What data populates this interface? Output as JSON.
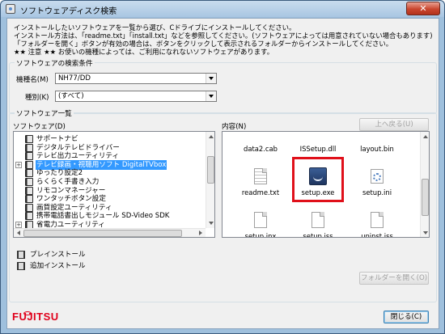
{
  "window": {
    "title": "ソフトウェアディスク検索",
    "close_symbol": "✕"
  },
  "intro": [
    "インストールしたいソフトウェアを一覧から選び、Cドライブにインストールしてください。",
    "インストール方法は、「readme.txt」「install.txt」などを参照してください。(ソフトウェアによっては用意されていない場合もあります)",
    "「フォルダーを開く」ボタンが有効の場合は、ボタンをクリックして表示されるフォルダーからインストールしてください。",
    "★★ 注意 ★★ お使いの機種によっては、ご利用になれないソフトウェアがあります。"
  ],
  "search": {
    "group_title": "ソフトウェアの検索条件",
    "model_label": "機種名(M)",
    "model_value": "NH77/DD",
    "type_label": "種別(K)",
    "type_value": "(すべて)"
  },
  "list": {
    "group_title": "ソフトウェア一覧",
    "software_label": "ソフトウェア(D)",
    "contents_label": "内容(N)",
    "up_button": "上へ戻る(U)",
    "open_folder_button": "フォルダーを開く(O)"
  },
  "tree": [
    {
      "label": "サポートナビ",
      "expandable": false,
      "selected": false
    },
    {
      "label": "デジタルテレビドライバー",
      "expandable": false,
      "selected": false
    },
    {
      "label": "テレビ出力ユーティリティ",
      "expandable": false,
      "selected": false
    },
    {
      "label": "テレビ録画・視聴用ソフト DigitalTVbox",
      "expandable": true,
      "selected": true
    },
    {
      "label": "ゆったり設定2",
      "expandable": false,
      "selected": false
    },
    {
      "label": "らくらく手書き入力",
      "expandable": false,
      "selected": false
    },
    {
      "label": "リモコンマネージャー",
      "expandable": false,
      "selected": false
    },
    {
      "label": "ワンタッチボタン設定",
      "expandable": false,
      "selected": false
    },
    {
      "label": "画質設定ユーティリティ",
      "expandable": false,
      "selected": false
    },
    {
      "label": "携帯電話書出しモジュール SD-Video SDK",
      "expandable": false,
      "selected": false
    },
    {
      "label": "省電力ユーティリティ",
      "expandable": true,
      "selected": false
    }
  ],
  "files": [
    {
      "name": "data2.cab",
      "icon": "none"
    },
    {
      "name": "ISSetup.dll",
      "icon": "none"
    },
    {
      "name": "layout.bin",
      "icon": "none"
    },
    {
      "name": "readme.txt",
      "icon": "text-document-icon"
    },
    {
      "name": "setup.exe",
      "icon": "setup-exe-icon",
      "highlighted": true
    },
    {
      "name": "setup.ini",
      "icon": "settings-file-icon"
    },
    {
      "name": "setup.inx",
      "icon": "document-icon"
    },
    {
      "name": "setup.iss",
      "icon": "document-icon"
    },
    {
      "name": "uninst.iss",
      "icon": "document-icon"
    }
  ],
  "install_links": {
    "preinstall": "プレインストール",
    "additional": "追加インストール"
  },
  "footer": {
    "logo": "FUJITSU",
    "close_button": "閉じる(C)"
  },
  "colors": {
    "selection": "#3399ff",
    "highlight_box": "#e0101a",
    "logo": "#e0001b",
    "titlebar": "#a9c6e2"
  }
}
